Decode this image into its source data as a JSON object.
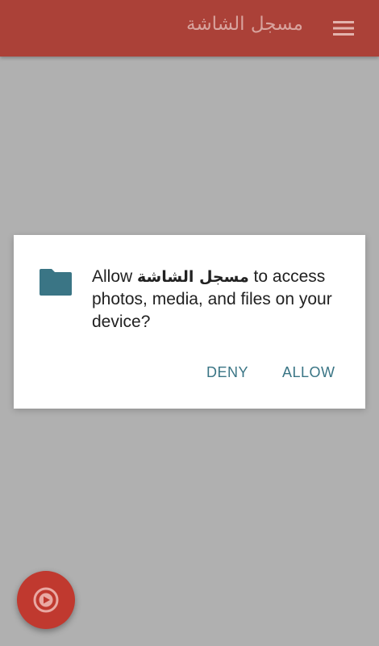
{
  "app_bar": {
    "title": "مسجل الشاشة",
    "menu_icon": "hamburger-menu-icon",
    "color": "#ab4138"
  },
  "permission_dialog": {
    "icon": "folder-icon",
    "message_prefix": "Allow ",
    "app_name": "مسجل الشاشة",
    "message_suffix": " to access photos, media, and files on your device?",
    "deny_label": "DENY",
    "allow_label": "ALLOW",
    "accent_color": "#3a7585"
  },
  "fab": {
    "icon": "play-circle-icon",
    "color": "#c0392f"
  },
  "background_color": "#b0b0b0"
}
